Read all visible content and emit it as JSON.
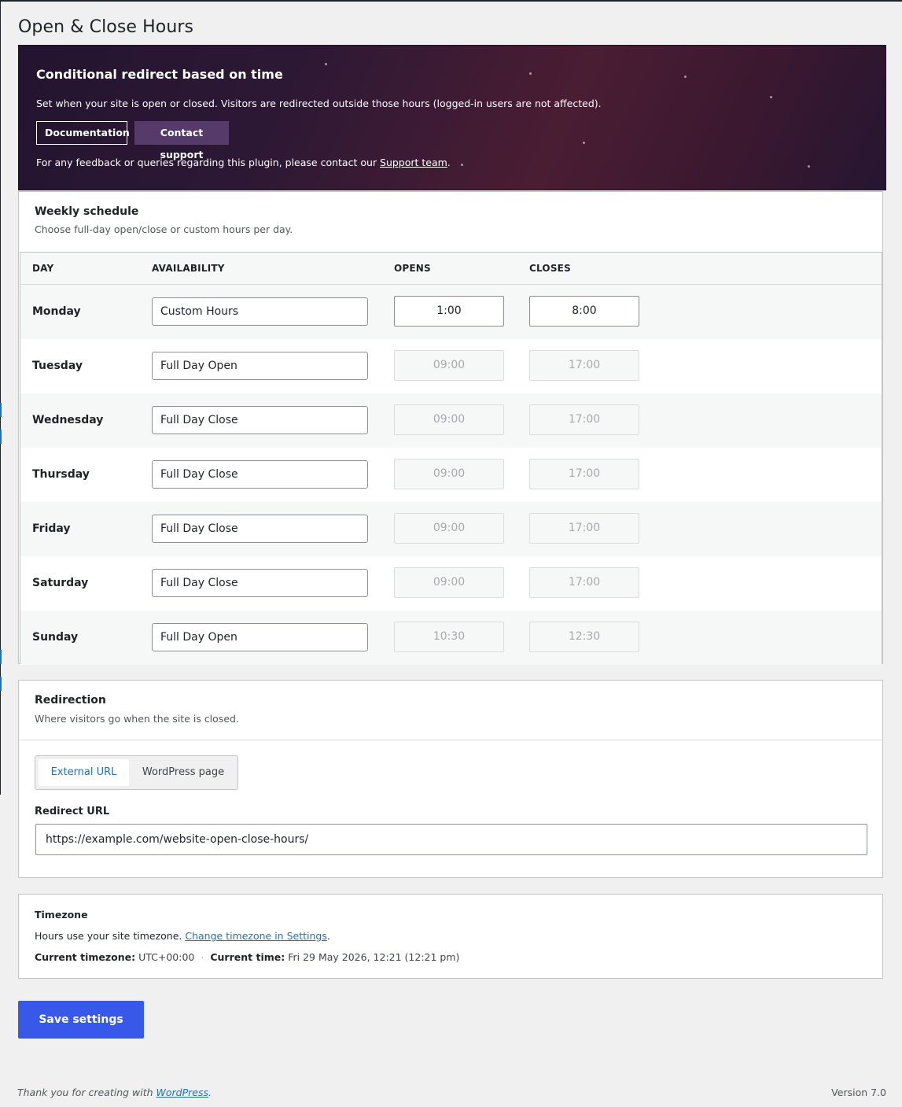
{
  "page": {
    "title": "Open & Close Hours"
  },
  "hero": {
    "title": "Conditional redirect based on time",
    "description": "Set when your site is open or closed. Visitors are redirected outside those hours (logged-in users are not affected).",
    "documentation_label": "Documentation",
    "support_label": "Contact support",
    "feedback_text": "For any feedback or queries regarding this plugin, please contact our ",
    "feedback_link": "Support team",
    "feedback_end": "."
  },
  "schedule": {
    "title": "Weekly schedule",
    "subtitle": "Choose full-day open/close or custom hours per day.",
    "columns": {
      "day": "DAY",
      "availability": "AVAILABILITY",
      "opens": "OPENS",
      "closes": "CLOSES"
    },
    "rows": [
      {
        "day": "Monday",
        "availability": "Custom Hours",
        "opens": "1:00",
        "closes": "8:00"
      },
      {
        "day": "Tuesday",
        "availability": "Full Day Open",
        "opens": "09:00",
        "closes": "17:00"
      },
      {
        "day": "Wednesday",
        "availability": "Full Day Close",
        "opens": "09:00",
        "closes": "17:00"
      },
      {
        "day": "Thursday",
        "availability": "Full Day Close",
        "opens": "09:00",
        "closes": "17:00"
      },
      {
        "day": "Friday",
        "availability": "Full Day Close",
        "opens": "09:00",
        "closes": "17:00"
      },
      {
        "day": "Saturday",
        "availability": "Full Day Close",
        "opens": "09:00",
        "closes": "17:00"
      },
      {
        "day": "Sunday",
        "availability": "Full Day Open",
        "opens": "10:30",
        "closes": "12:30"
      }
    ]
  },
  "redirection": {
    "title": "Redirection",
    "subtitle": "Where visitors go when the site is closed.",
    "tab_external": "External URL",
    "tab_page": "WordPress page",
    "url_label": "Redirect URL",
    "url_value": "https://example.com/website-open-close-hours/"
  },
  "timezone": {
    "title": "Timezone",
    "text": "Hours use your site timezone. ",
    "link": "Change timezone in Settings",
    "link_end": ".",
    "current_tz_label": "Current timezone:",
    "current_tz_value": "UTC+00:00",
    "separator": "·",
    "current_time_label": "Current time:",
    "current_time_value": "Fri 29 May 2026, 12:21 (12:21 pm)"
  },
  "save_label": "Save settings",
  "footer": {
    "thanks": "Thank you for creating with ",
    "wp_link": "WordPress",
    "thanks_end": ".",
    "version": "Version 7.0"
  },
  "colors": {
    "accent": "#2271b1",
    "primary_button": "#3858e9",
    "hero_support_button": "#553a6a"
  }
}
